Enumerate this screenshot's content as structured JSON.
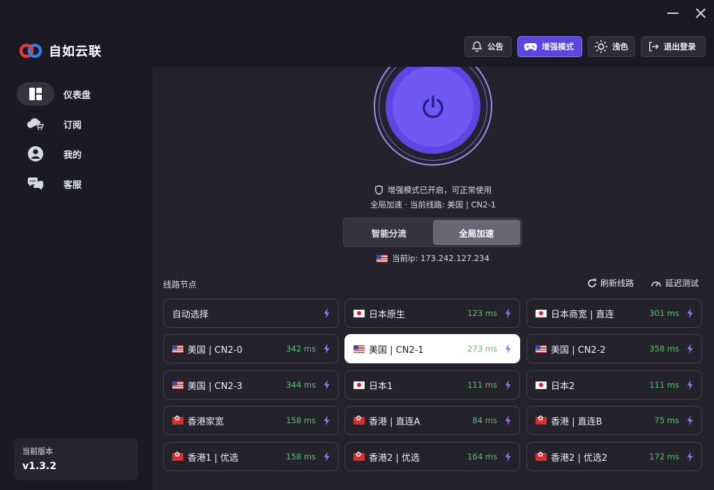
{
  "app": {
    "name": "自如云联"
  },
  "sidebar": {
    "items": [
      {
        "label": "仪表盘",
        "icon": "dashboard-icon",
        "active": true
      },
      {
        "label": "订阅",
        "icon": "cloud-cart-icon",
        "active": false
      },
      {
        "label": "我的",
        "icon": "user-icon",
        "active": false
      },
      {
        "label": "客服",
        "icon": "chat-icon",
        "active": false
      }
    ],
    "version_label": "当前版本",
    "version": "v1.3.2"
  },
  "toolbar": {
    "notice": "公告",
    "enhanced": "增强模式",
    "theme": "浅色",
    "logout": "退出登录"
  },
  "status": {
    "enhanced_msg": "增强模式已开启，可正常使用",
    "route_msg": "全局加速 · 当前线路: 美国 | CN2-1",
    "current_ip": "当前ip: 173.242.127.234"
  },
  "mode": {
    "smart": "智能分流",
    "global": "全局加速",
    "selected": "global"
  },
  "nodes_section": {
    "title": "线路节点",
    "refresh": "刷新线路",
    "latency_test": "延迟测试"
  },
  "nodes": [
    {
      "name": "自动选择",
      "flag": "",
      "latency": ""
    },
    {
      "name": "日本原生",
      "flag": "jp",
      "latency": "123 ms"
    },
    {
      "name": "日本商宽 | 直连",
      "flag": "jp",
      "latency": "301 ms"
    },
    {
      "name": "美国 | CN2-0",
      "flag": "us",
      "latency": "342 ms"
    },
    {
      "name": "美国 | CN2-1",
      "flag": "us",
      "latency": "273 ms",
      "selected": true
    },
    {
      "name": "美国 | CN2-2",
      "flag": "us",
      "latency": "358 ms"
    },
    {
      "name": "美国 | CN2-3",
      "flag": "us",
      "latency": "344 ms"
    },
    {
      "name": "日本1",
      "flag": "jp",
      "latency": "111 ms"
    },
    {
      "name": "日本2",
      "flag": "jp",
      "latency": "111 ms"
    },
    {
      "name": "香港家宽",
      "flag": "hk",
      "latency": "158 ms"
    },
    {
      "name": "香港 | 直连A",
      "flag": "hk",
      "latency": "84 ms"
    },
    {
      "name": "香港 | 直连B",
      "flag": "hk",
      "latency": "75 ms"
    },
    {
      "name": "香港1 | 优选",
      "flag": "hk",
      "latency": "158 ms"
    },
    {
      "name": "香港2 | 优选",
      "flag": "hk",
      "latency": "164 ms"
    },
    {
      "name": "香港2 | 优选2",
      "flag": "hk",
      "latency": "172 ms"
    }
  ],
  "colors": {
    "accent": "#5b45e0",
    "latency": "#55c46a",
    "bolt": "#8c7af5"
  }
}
